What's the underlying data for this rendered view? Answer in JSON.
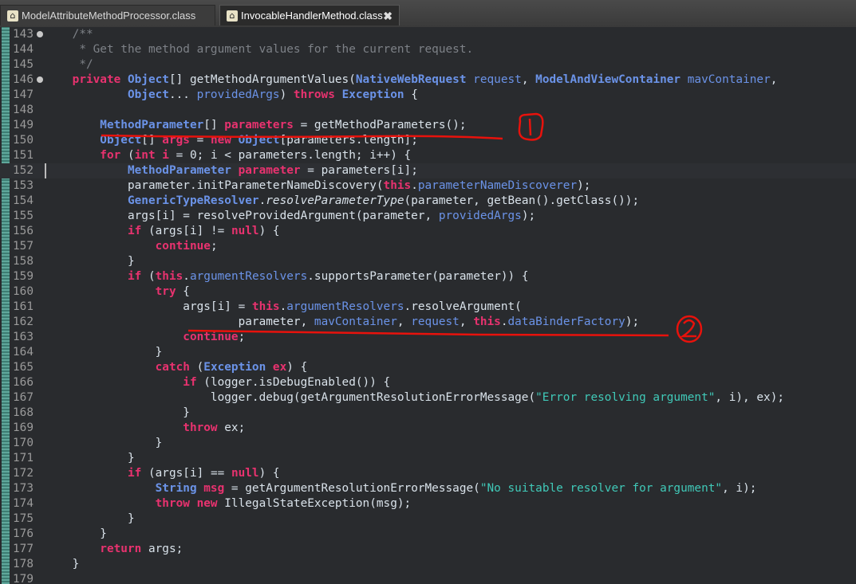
{
  "tabs": [
    {
      "label": "ModelAttributeMethodProcessor.class"
    },
    {
      "label": "InvocableHandlerMethod.class",
      "close": "✖"
    }
  ],
  "code": [
    {
      "n": "143",
      "fold": true,
      "tokens": [
        [
          "c",
          "    /**"
        ]
      ]
    },
    {
      "n": "144",
      "tokens": [
        [
          "c",
          "     * Get the method argument values for the current request."
        ]
      ]
    },
    {
      "n": "145",
      "tokens": [
        [
          "c",
          "     */"
        ]
      ]
    },
    {
      "n": "146",
      "fold": true,
      "tokens": [
        [
          "k",
          "    private "
        ],
        [
          "t",
          "Object"
        ],
        [
          "m",
          "[] getMethodArgumentValues("
        ],
        [
          "t",
          "NativeWebRequest"
        ],
        [
          "v",
          " request"
        ],
        [
          "m",
          ", "
        ],
        [
          "t",
          "ModelAndViewContainer"
        ],
        [
          "v",
          " mavContainer"
        ],
        [
          "m",
          ","
        ]
      ]
    },
    {
      "n": "147",
      "tokens": [
        [
          "t",
          "            Object"
        ],
        [
          "m",
          "... "
        ],
        [
          "v",
          "providedArgs"
        ],
        [
          "m",
          ") "
        ],
        [
          "k",
          "throws "
        ],
        [
          "t",
          "Exception"
        ],
        [
          "m",
          " {"
        ]
      ]
    },
    {
      "n": "148",
      "tokens": [
        [
          "m",
          " "
        ]
      ]
    },
    {
      "n": "149",
      "tokens": [
        [
          "t",
          "        MethodParameter"
        ],
        [
          "m",
          "[] "
        ],
        [
          "k",
          "parameters"
        ],
        [
          "m",
          " = getMethodParameters();"
        ]
      ]
    },
    {
      "n": "150",
      "tokens": [
        [
          "t",
          "        Object"
        ],
        [
          "m",
          "[] "
        ],
        [
          "k",
          "args"
        ],
        [
          "m",
          " = "
        ],
        [
          "k",
          "new "
        ],
        [
          "t",
          "Object"
        ],
        [
          "m",
          "[parameters.length];"
        ]
      ]
    },
    {
      "n": "151",
      "tokens": [
        [
          "k",
          "        for "
        ],
        [
          "m",
          "("
        ],
        [
          "k",
          "int i"
        ],
        [
          "m",
          " = 0; i < parameters.length; i++) {"
        ]
      ]
    },
    {
      "n": "152",
      "current": true,
      "tokens": [
        [
          "t",
          "            MethodParameter"
        ],
        [
          "k",
          " parameter"
        ],
        [
          "m",
          " = parameters[i];"
        ]
      ]
    },
    {
      "n": "153",
      "tokens": [
        [
          "m",
          "            parameter.initParameterNameDiscovery("
        ],
        [
          "k",
          "this"
        ],
        [
          "m",
          "."
        ],
        [
          "v",
          "parameterNameDiscoverer"
        ],
        [
          "m",
          ");"
        ]
      ]
    },
    {
      "n": "154",
      "tokens": [
        [
          "t",
          "            GenericTypeResolver"
        ],
        [
          "m",
          "."
        ],
        [
          "it",
          "resolveParameterType"
        ],
        [
          "m",
          "(parameter, getBean().getClass());"
        ]
      ]
    },
    {
      "n": "155",
      "tokens": [
        [
          "m",
          "            args[i] = resolveProvidedArgument(parameter, "
        ],
        [
          "v",
          "providedArgs"
        ],
        [
          "m",
          ");"
        ]
      ]
    },
    {
      "n": "156",
      "tokens": [
        [
          "k",
          "            if "
        ],
        [
          "m",
          "(args[i] != "
        ],
        [
          "k",
          "null"
        ],
        [
          "m",
          ") {"
        ]
      ]
    },
    {
      "n": "157",
      "tokens": [
        [
          "k",
          "                continue"
        ],
        [
          "m",
          ";"
        ]
      ]
    },
    {
      "n": "158",
      "tokens": [
        [
          "m",
          "            }"
        ]
      ]
    },
    {
      "n": "159",
      "tokens": [
        [
          "k",
          "            if "
        ],
        [
          "m",
          "("
        ],
        [
          "k",
          "this"
        ],
        [
          "m",
          "."
        ],
        [
          "v",
          "argumentResolvers"
        ],
        [
          "m",
          ".supportsParameter(parameter)) {"
        ]
      ]
    },
    {
      "n": "160",
      "tokens": [
        [
          "k",
          "                try"
        ],
        [
          "m",
          " {"
        ]
      ]
    },
    {
      "n": "161",
      "tokens": [
        [
          "m",
          "                    args[i] = "
        ],
        [
          "k",
          "this"
        ],
        [
          "m",
          "."
        ],
        [
          "v",
          "argumentResolvers"
        ],
        [
          "m",
          ".resolveArgument("
        ]
      ]
    },
    {
      "n": "162",
      "tokens": [
        [
          "m",
          "                            parameter, "
        ],
        [
          "v",
          "mavContainer"
        ],
        [
          "m",
          ", "
        ],
        [
          "v",
          "request"
        ],
        [
          "m",
          ", "
        ],
        [
          "k",
          "this"
        ],
        [
          "m",
          "."
        ],
        [
          "v",
          "dataBinderFactory"
        ],
        [
          "m",
          ");"
        ]
      ]
    },
    {
      "n": "163",
      "tokens": [
        [
          "k",
          "                    continue"
        ],
        [
          "m",
          ";"
        ]
      ]
    },
    {
      "n": "164",
      "tokens": [
        [
          "m",
          "                }"
        ]
      ]
    },
    {
      "n": "165",
      "tokens": [
        [
          "k",
          "                catch "
        ],
        [
          "m",
          "("
        ],
        [
          "t",
          "Exception"
        ],
        [
          "k",
          " ex"
        ],
        [
          "m",
          ") {"
        ]
      ]
    },
    {
      "n": "166",
      "tokens": [
        [
          "k",
          "                    if "
        ],
        [
          "m",
          "(logger.isDebugEnabled()) {"
        ]
      ]
    },
    {
      "n": "167",
      "tokens": [
        [
          "m",
          "                        logger.debug(getArgumentResolutionErrorMessage("
        ],
        [
          "s",
          "\"Error resolving argument\""
        ],
        [
          "m",
          ", i), ex);"
        ]
      ]
    },
    {
      "n": "168",
      "tokens": [
        [
          "m",
          "                    }"
        ]
      ]
    },
    {
      "n": "169",
      "tokens": [
        [
          "k",
          "                    throw"
        ],
        [
          "m",
          " ex;"
        ]
      ]
    },
    {
      "n": "170",
      "tokens": [
        [
          "m",
          "                }"
        ]
      ]
    },
    {
      "n": "171",
      "tokens": [
        [
          "m",
          "            }"
        ]
      ]
    },
    {
      "n": "172",
      "tokens": [
        [
          "k",
          "            if "
        ],
        [
          "m",
          "(args[i] == "
        ],
        [
          "k",
          "null"
        ],
        [
          "m",
          ") {"
        ]
      ]
    },
    {
      "n": "173",
      "tokens": [
        [
          "t",
          "                String"
        ],
        [
          "k",
          " msg"
        ],
        [
          "m",
          " = getArgumentResolutionErrorMessage("
        ],
        [
          "s",
          "\"No suitable resolver for argument\""
        ],
        [
          "m",
          ", i);"
        ]
      ]
    },
    {
      "n": "174",
      "tokens": [
        [
          "k",
          "                throw new "
        ],
        [
          "m",
          "IllegalStateException(msg);"
        ]
      ]
    },
    {
      "n": "175",
      "tokens": [
        [
          "m",
          "            }"
        ]
      ]
    },
    {
      "n": "176",
      "tokens": [
        [
          "m",
          "        }"
        ]
      ]
    },
    {
      "n": "177",
      "tokens": [
        [
          "k",
          "        return"
        ],
        [
          "m",
          " args;"
        ]
      ]
    },
    {
      "n": "178",
      "tokens": [
        [
          "m",
          "    }"
        ]
      ]
    },
    {
      "n": "179",
      "tokens": [
        [
          "m",
          " "
        ]
      ]
    }
  ],
  "annotations": {
    "mark1": "1",
    "mark2": "2",
    "color": "#e8120c"
  }
}
